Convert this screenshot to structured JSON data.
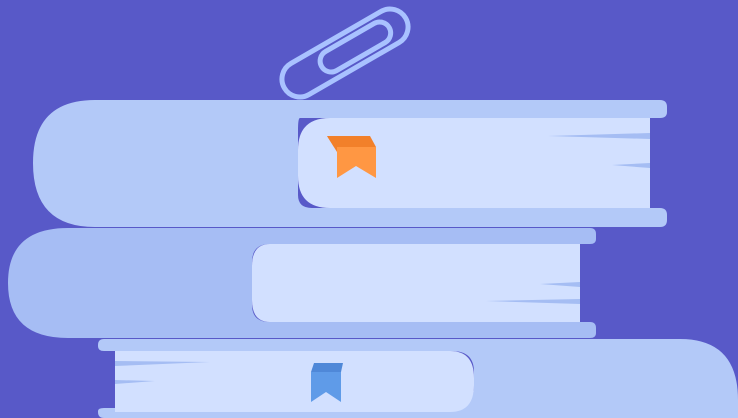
{
  "illustration": {
    "subject": "stack-of-books",
    "colors": {
      "background": "#5859c8",
      "cover_light": "#b3c9f8",
      "cover_mid": "#a6bdf4",
      "pages": "#d2e0ff",
      "page_lines": "#a5bdf3",
      "paperclip": "#a9c2ff",
      "bookmark_orange": "#ff9743",
      "bookmark_orange_dark": "#f2802a",
      "bookmark_blue": "#5f9be8",
      "bookmark_blue_dark": "#4f88d8"
    },
    "elements": {
      "paperclip": "paperclip-icon",
      "top_bookmark": "bookmark-icon",
      "bottom_bookmark": "bookmark-icon"
    }
  }
}
